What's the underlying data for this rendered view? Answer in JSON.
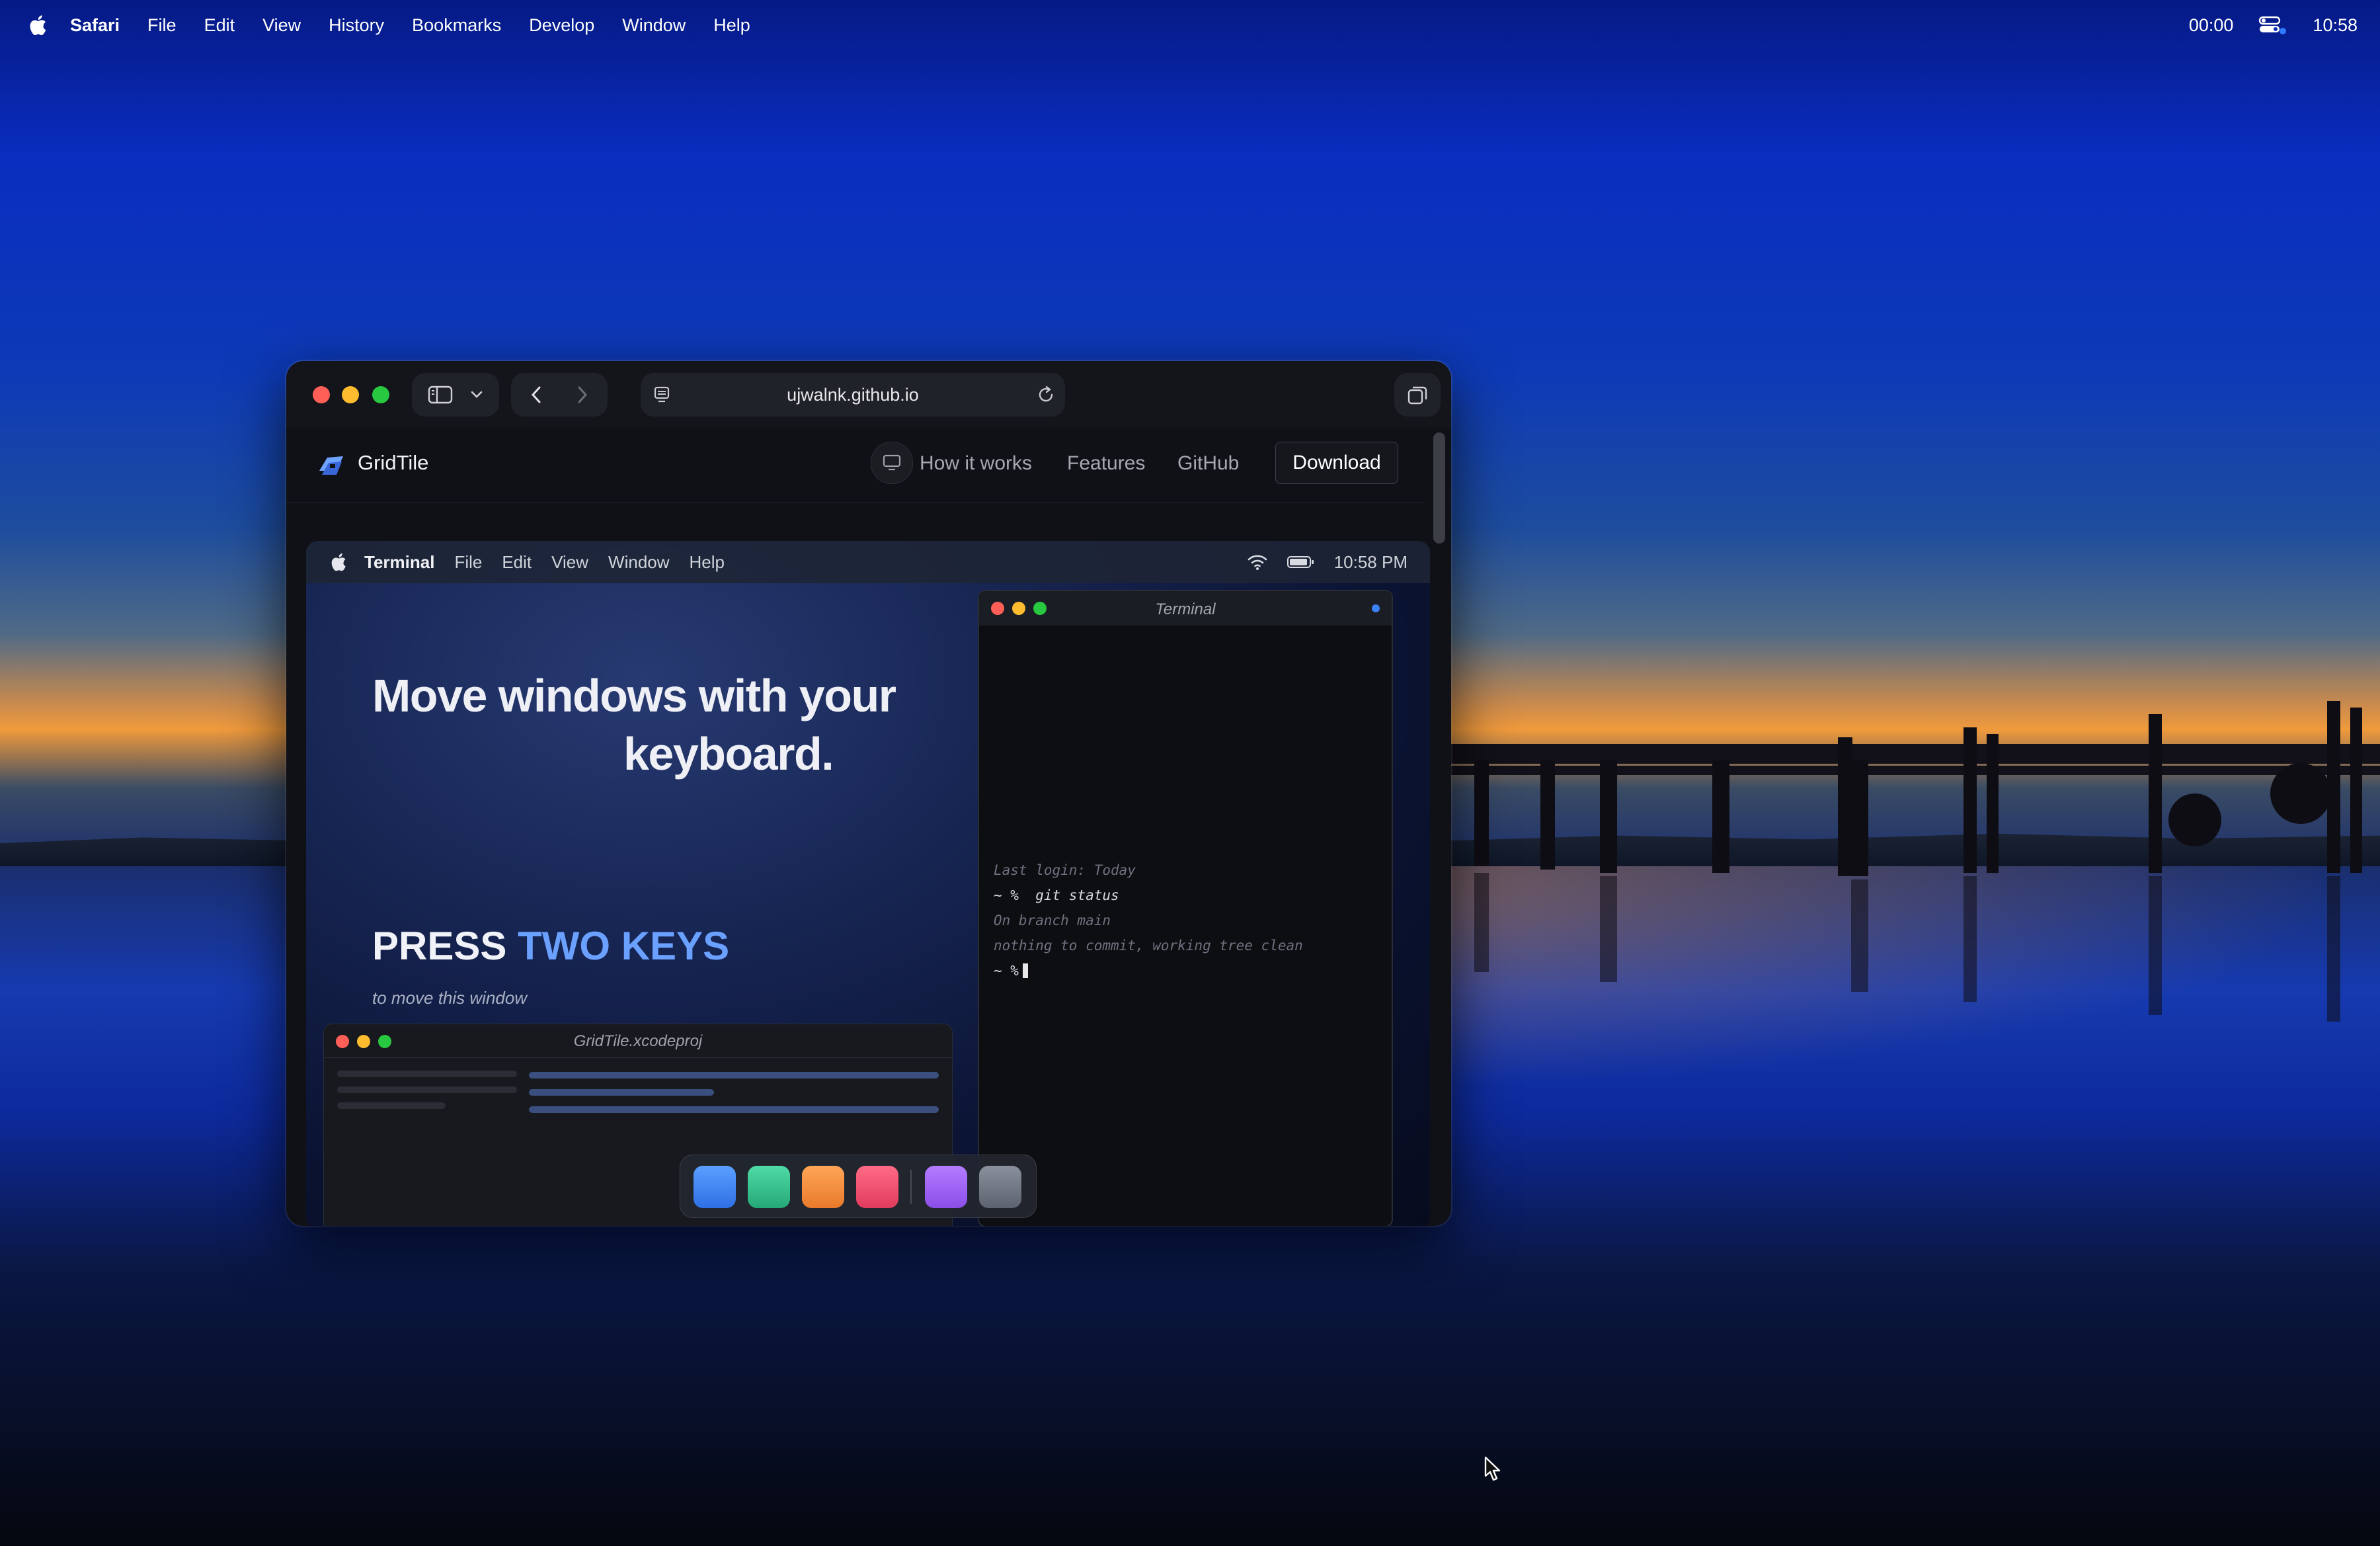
{
  "menubar": {
    "app_name": "Safari",
    "items": [
      "File",
      "Edit",
      "View",
      "History",
      "Bookmarks",
      "Develop",
      "Window",
      "Help"
    ],
    "timer": "00:00",
    "clock": "10:58"
  },
  "browser": {
    "url": "ujwalnk.github.io",
    "site": {
      "brand": "GridTile",
      "nav": [
        "How it works",
        "Features",
        "GitHub"
      ],
      "download_label": "Download"
    },
    "demo": {
      "menubar": {
        "app_name": "Terminal",
        "items": [
          "File",
          "Edit",
          "View",
          "Window",
          "Help"
        ],
        "clock": "10:58 PM"
      },
      "hero_line1": "Move windows with your",
      "hero_line2": "keyboard.",
      "press_prefix": "PRESS ",
      "press_accent": "TWO KEYS",
      "press_sub": "to move this window",
      "xcode_title": "GridTile.xcodeproj",
      "terminal": {
        "title": "Terminal",
        "lines": [
          "Last login: Today",
          "~ %  git status",
          "On branch main",
          "nothing to commit, working tree clean",
          "~ %"
        ]
      }
    }
  },
  "icons": [
    "apple-icon",
    "control-center-icon",
    "sidebar-icon",
    "chevron-down-icon",
    "back-icon",
    "forward-icon",
    "page-menu-icon",
    "reload-icon",
    "tabs-overview-icon",
    "monitor-icon",
    "wifi-icon",
    "battery-icon",
    "pointer-icon"
  ],
  "colors": {
    "accent_blue": "#6aa0ff",
    "traffic_red": "#ff5f57",
    "traffic_yellow": "#febc2e",
    "traffic_green": "#28c840",
    "dock_apps": [
      "#3b82f6",
      "#34c38f",
      "#f08c3a",
      "#ef4d6a",
      "#9a5cf0",
      "#6b7280"
    ]
  }
}
